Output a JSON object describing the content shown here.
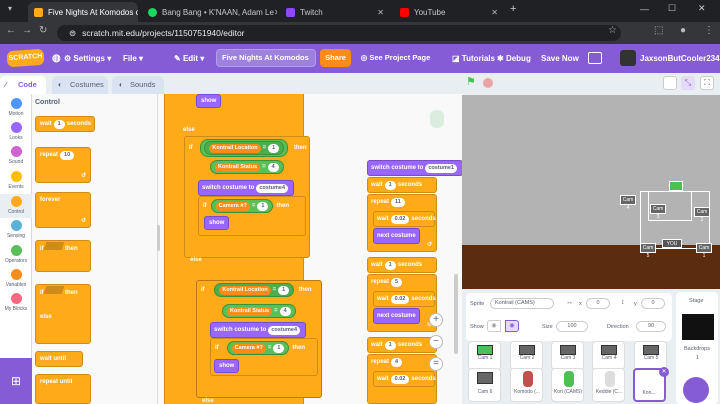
{
  "browser": {
    "tabs": [
      {
        "title": "Five Nights At Komodos on Sc",
        "icon_color": "#ffab19",
        "active": true
      },
      {
        "title": "Bang Bang • K'NAAN, Adam Le",
        "icon_color": "#1ed760",
        "active": false
      },
      {
        "title": "Twitch",
        "icon_color": "#9146ff",
        "active": false
      },
      {
        "title": "YouTube",
        "icon_color": "#ff0000",
        "active": false
      }
    ],
    "new_tab": "+",
    "url": "scratch.mit.edu/projects/1150751940/editor"
  },
  "menubar": {
    "logo": "SCRATCH",
    "settings": "Settings",
    "file": "File",
    "edit": "Edit",
    "project_title": "Five Nights At Komodos",
    "share": "Share",
    "see_project_page": "See Project Page",
    "tutorials": "Tutorials",
    "debug": "Debug",
    "save_now": "Save Now",
    "username": "JaxsonButCooler234"
  },
  "editor_tabs": {
    "code": "Code",
    "costumes": "Costumes",
    "sounds": "Sounds"
  },
  "categories": [
    {
      "label": "Motion",
      "color": "#4c97ff"
    },
    {
      "label": "Looks",
      "color": "#9966ff"
    },
    {
      "label": "Sound",
      "color": "#cf63cf"
    },
    {
      "label": "Events",
      "color": "#ffbf00"
    },
    {
      "label": "Control",
      "color": "#ffab19"
    },
    {
      "label": "Sensing",
      "color": "#5cb1d6"
    },
    {
      "label": "Operators",
      "color": "#59c059"
    },
    {
      "label": "Variables",
      "color": "#ff8c1a"
    },
    {
      "label": "My Blocks",
      "color": "#ff6680"
    }
  ],
  "palette": {
    "heading": "Control",
    "wait": "wait",
    "wait_value": "1",
    "seconds": "seconds",
    "repeat": "repeat",
    "repeat_value": "10",
    "forever": "forever",
    "if": "if",
    "then": "then",
    "else": "else",
    "wait_until": "wait until",
    "repeat_until": "repeat until"
  },
  "script": {
    "show": "show",
    "else": "else",
    "if": "if",
    "then": "then",
    "kontrail_location": "Kontrail Location",
    "kontrail_status": "Kontrail Status",
    "equals": "=",
    "loc_value": "1",
    "status_value": "4",
    "switch_costume_to": "switch costume to",
    "costume4": "costume4",
    "costume1": "costume1",
    "camera_var": "Camera #?",
    "camera_value": "1",
    "wait": "wait",
    "seconds": "seconds",
    "repeat": "repeat",
    "next_costume": "next costume",
    "w1": "1",
    "r1": "11",
    "w2": "0.02",
    "w3": "1",
    "r2": "5",
    "w4": "0.02",
    "w5": "1",
    "r3": "4",
    "w6": "0.02",
    "zoom_in": "+",
    "zoom_out": "−",
    "zoom_reset": "="
  },
  "stage": {
    "cams": [
      "Cam 4",
      "Cam 3",
      "Cam 2",
      "Cam 5",
      "Cam 1",
      "Cam 6",
      "YOU",
      "Cam 1"
    ]
  },
  "sprite_info": {
    "sprite_label": "Sprite",
    "sprite_name": "Kontrail (CAMS)",
    "x_label": "x",
    "x_value": "0",
    "y_label": "y",
    "y_value": "0",
    "show_label": "Show",
    "size_label": "Size",
    "size_value": "100",
    "direction_label": "Direction",
    "direction_value": "90"
  },
  "sprites": [
    {
      "name": "Cam 1"
    },
    {
      "name": "Cam 2"
    },
    {
      "name": "Cam 3"
    },
    {
      "name": "Cam 4"
    },
    {
      "name": "Cam 5"
    },
    {
      "name": "Cam 6"
    },
    {
      "name": "Komodo (..."
    },
    {
      "name": "Kori (CAMS)"
    },
    {
      "name": "Keddie (C..."
    },
    {
      "name": "Kon..."
    }
  ],
  "stage_pane": {
    "label": "Stage",
    "backdrops": "Backdrops",
    "backdrop_count": "1"
  }
}
